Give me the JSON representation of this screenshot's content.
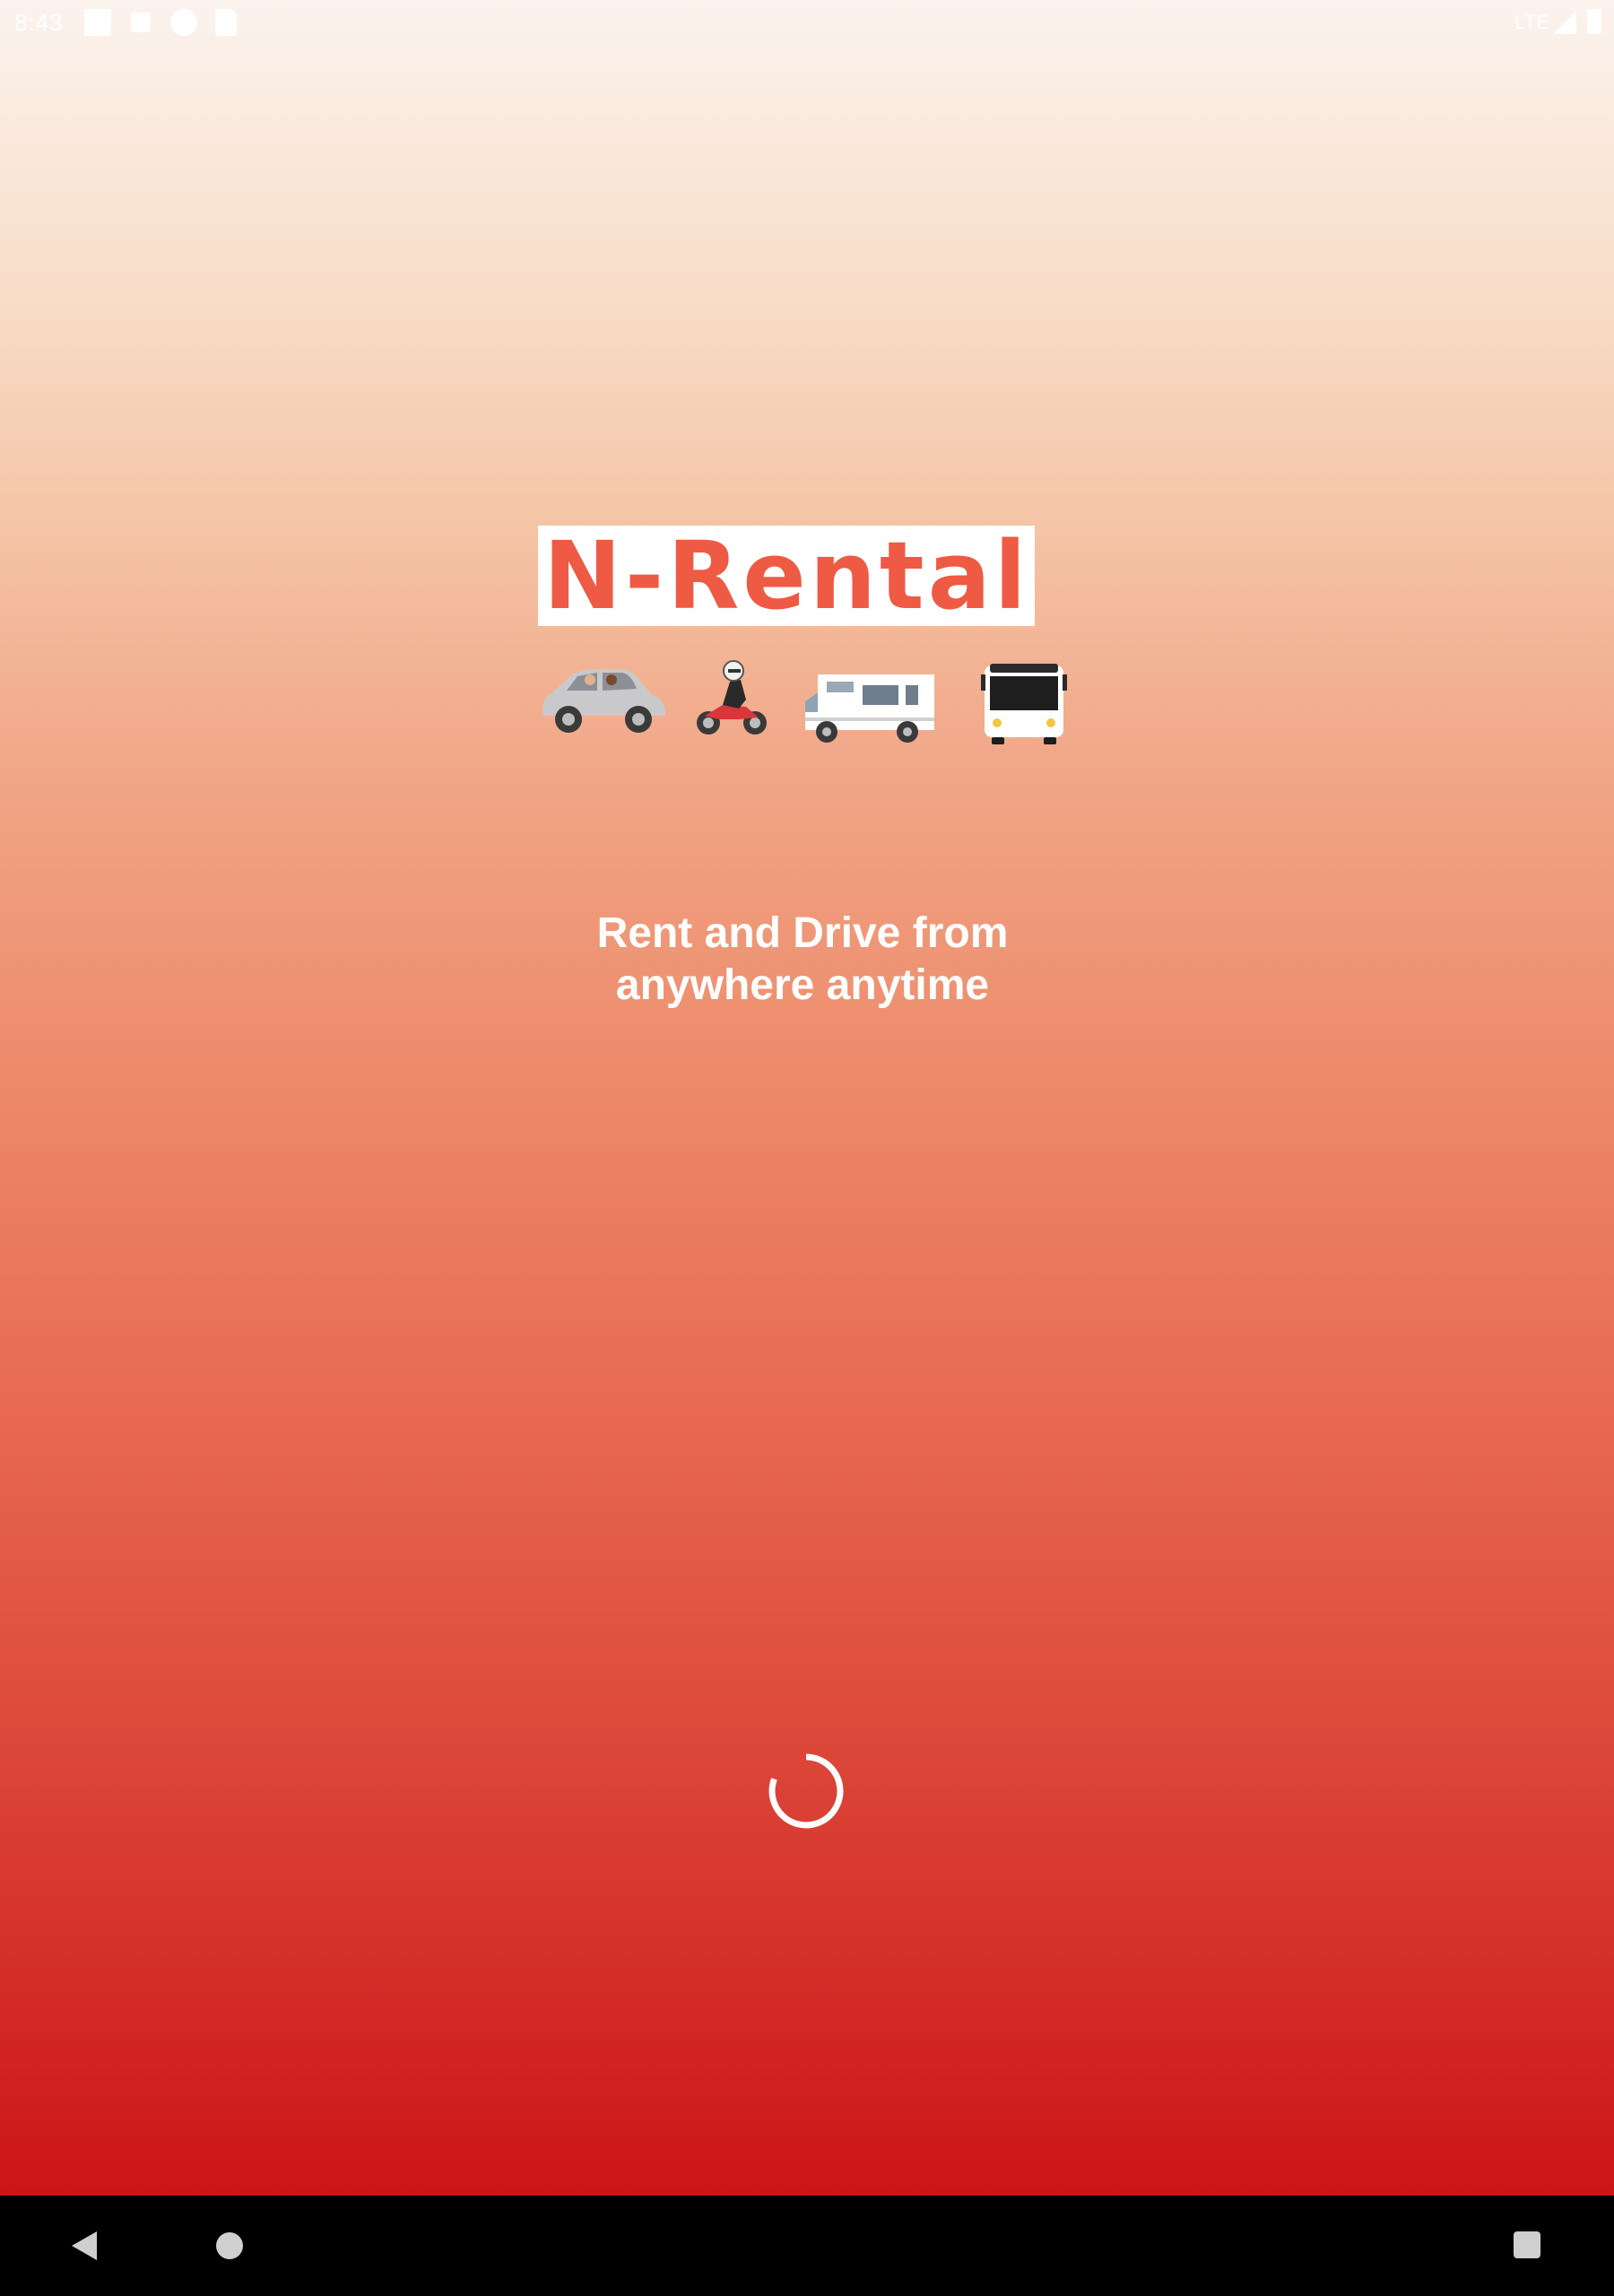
{
  "status_bar": {
    "time": "8:43",
    "network": "LTE",
    "icons": [
      "notification-square-icon",
      "notification-box-icon",
      "notification-circle-icon",
      "sd-card-icon",
      "signal-icon",
      "battery-icon"
    ]
  },
  "app": {
    "logo_text": "N-Rental",
    "vehicles": [
      "car-icon",
      "motorbike-icon",
      "camper-van-icon",
      "bus-icon"
    ],
    "tagline_line1": "Rent and Drive from",
    "tagline_line2": "anywhere anytime",
    "loading": true
  },
  "colors": {
    "brand": "#ee5a43",
    "gradient_top": "#fbf3ee",
    "gradient_bottom": "#cc1418",
    "text": "#ffffff"
  },
  "nav_bar": {
    "buttons": [
      "back-icon",
      "home-icon",
      "recents-icon"
    ]
  }
}
